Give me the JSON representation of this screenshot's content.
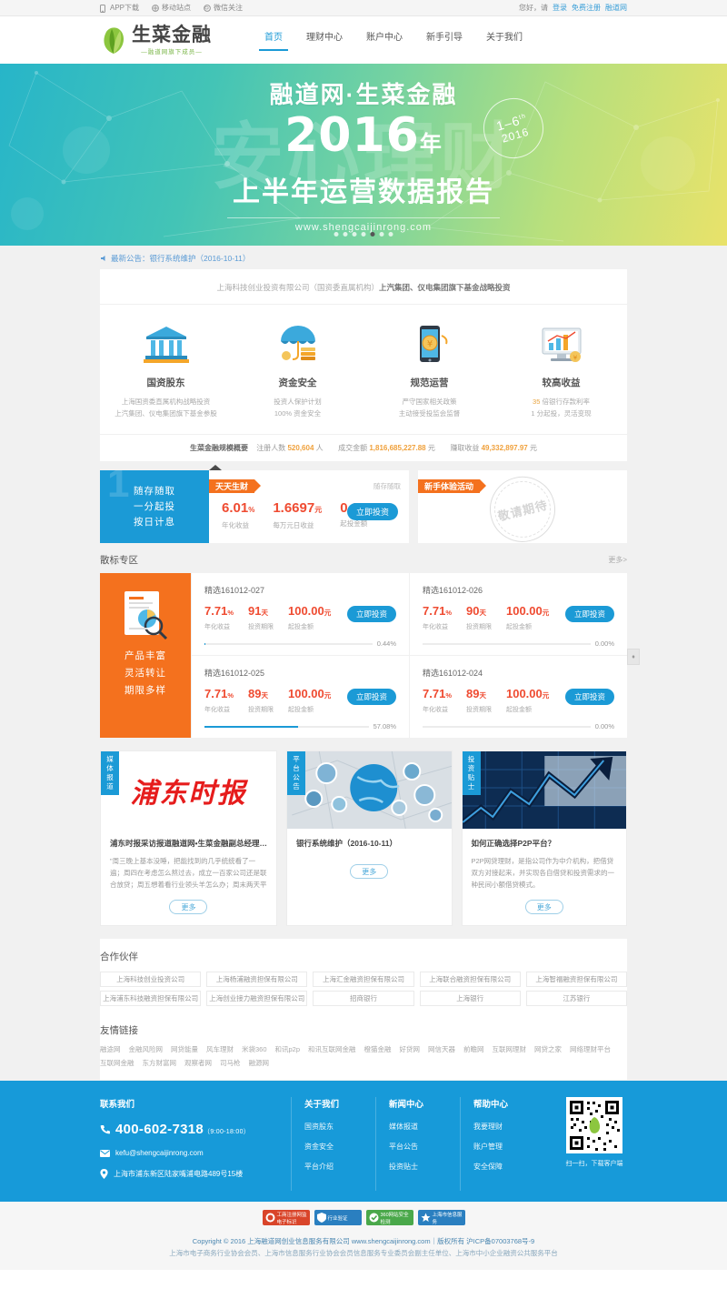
{
  "topbar": {
    "left": [
      {
        "icon": "phone-icon",
        "label": "APP下载"
      },
      {
        "icon": "mobile-site-icon",
        "label": "移动站点"
      },
      {
        "icon": "wechat-icon",
        "label": "微信关注"
      }
    ],
    "greeting": "您好，请",
    "login": "登录",
    "register": "免费注册",
    "portal": "融道网"
  },
  "header": {
    "logo_name": "生菜金融",
    "logo_sub": "—融道网旗下成员—",
    "nav": [
      {
        "label": "首页",
        "active": true
      },
      {
        "label": "理财中心",
        "active": false
      },
      {
        "label": "账户中心",
        "active": false
      },
      {
        "label": "新手引导",
        "active": false
      },
      {
        "label": "关于我们",
        "active": false
      }
    ]
  },
  "hero": {
    "ghost": "安心理财",
    "line1": "融道网·生菜金融",
    "year": "2016",
    "year_suffix": "年",
    "line3": "上半年运营数据报告",
    "url": "www.shengcaijinrong.com",
    "badge_top": "1–6",
    "badge_sup": "th",
    "badge_bottom": "2016",
    "dots_count": 7,
    "active_dot": 4
  },
  "notice": {
    "icon": "horn-icon",
    "text": "最新公告：银行系统维护（2016-10-11）"
  },
  "trust": {
    "headline_gray": "上海科技创业投资有限公司（国资委直属机构）",
    "headline_bold": "上汽集团、仪电集团旗下基金战略投资",
    "features": [
      {
        "icon": "bank-icon",
        "title": "国资股东",
        "line1": "上海国资委直属机构战略投资",
        "line2": "上汽集团、仪电集团旗下基金参股"
      },
      {
        "icon": "umbrella-money-icon",
        "title": "资金安全",
        "line1": "投资人保护计划",
        "line2": "100% 资金安全"
      },
      {
        "icon": "mobile-coin-icon",
        "title": "规范运营",
        "line1": "严守国家相关政策",
        "line2": "主动接受投监会监督"
      },
      {
        "icon": "monitor-chart-icon",
        "title": "较高收益",
        "line1_hl": "35",
        "line1": "倍银行存款利率",
        "line2": "1 分起投，灵活变现"
      }
    ],
    "stats_label": "生菜金融规模概要",
    "stats": [
      {
        "label": "注册人数",
        "value": "520,604",
        "unit": "人"
      },
      {
        "label": "成交金额",
        "value": "1,816,685,227.88",
        "unit": "元"
      },
      {
        "label": "赚取收益",
        "value": "49,332,897.97",
        "unit": "元"
      }
    ]
  },
  "deposit": {
    "left_lines": [
      "随存随取",
      "一分起投",
      "按日计息"
    ],
    "left_ghost": "1",
    "ribbon": "天天生财",
    "anytime": "随存随取",
    "stats": [
      {
        "value": "6.01",
        "unit": "%",
        "label": "年化收益"
      },
      {
        "value": "1.6697",
        "unit": "元",
        "label": "每万元日收益"
      },
      {
        "value": "0.01",
        "unit": "",
        "label": "起投金额"
      }
    ],
    "button": "立即投资",
    "promo_ribbon": "新手体验活动",
    "promo_stamp": "敬请期待"
  },
  "loans": {
    "section_title": "散标专区",
    "more": "更多>",
    "left_lines": [
      "产品丰富",
      "灵活转让",
      "期限多样"
    ],
    "left_icon": "document-search-icon",
    "side_tab": "♦",
    "items": [
      {
        "title": "精选161012-027",
        "rate": "7.71",
        "rate_unit": "%",
        "rate_label": "年化收益",
        "term": "91",
        "term_unit": "天",
        "term_label": "投资期限",
        "amount": "100.00",
        "amount_unit": "元",
        "amount_label": "起投金额",
        "button": "立即投资",
        "progress": "0.44%",
        "progress_value": 0.44
      },
      {
        "title": "精选161012-026",
        "rate": "7.71",
        "rate_unit": "%",
        "rate_label": "年化收益",
        "term": "90",
        "term_unit": "天",
        "term_label": "投资期限",
        "amount": "100.00",
        "amount_unit": "元",
        "amount_label": "起投金额",
        "button": "立即投资",
        "progress": "0.00%",
        "progress_value": 0
      },
      {
        "title": "精选161012-025",
        "rate": "7.71",
        "rate_unit": "%",
        "rate_label": "年化收益",
        "term": "89",
        "term_unit": "天",
        "term_label": "投资期限",
        "amount": "100.00",
        "amount_unit": "元",
        "amount_label": "起投金额",
        "button": "立即投资",
        "progress": "57.08%",
        "progress_value": 57.08
      },
      {
        "title": "精选161012-024",
        "rate": "7.71",
        "rate_unit": "%",
        "rate_label": "年化收益",
        "term": "89",
        "term_unit": "天",
        "term_label": "投资期限",
        "amount": "100.00",
        "amount_unit": "元",
        "amount_label": "起投金额",
        "button": "立即投资",
        "progress": "0.00%",
        "progress_value": 0
      }
    ]
  },
  "news": [
    {
      "tag": "媒体报道",
      "image": "pudong-times-masthead",
      "masthead": "浦东时报",
      "title": "浦东时报采访报道融道网•生菜金融副总经理…",
      "desc": "\"周三晚上基本没睡，把能找到的几乎统统看了一遍；周四在考虑怎么熬过去，成立一百家公司还是联合放贷；周五想着看行业领头羊怎么办；周末两天平",
      "button": "更多"
    },
    {
      "tag": "平台公告",
      "image": "global-network-photo",
      "masthead": "",
      "title": "银行系统维护（2016-10-11）",
      "desc": "",
      "button": "更多"
    },
    {
      "tag": "投资贴士",
      "image": "stock-arrow-photo",
      "masthead": "",
      "title": "如何正确选择P2P平台？",
      "desc": "P2P网贷理财，是指公司作为中介机构，把借贷双方对接起来，并实现各自借贷和投资需求的一种民间小额借贷模式。",
      "button": "更多"
    }
  ],
  "partners": {
    "title": "合作伙伴",
    "items": [
      "上海科技创业投资公司",
      "上海杨浦融资担保有限公司",
      "上海汇金融资担保有限公司",
      "上海联合融资担保有限公司",
      "上海智福融资担保有限公司",
      "上海浦东科技融资担保有限公司",
      "上海创业接力融资担保有限公司",
      "招商银行",
      "上海银行",
      "江苏银行"
    ]
  },
  "links": {
    "title": "友情链接",
    "items": [
      "融途网",
      "金融风险网",
      "网贷能量",
      "风车理财",
      "米袋360",
      "和讯p2p",
      "和讯互联网金融",
      "橙猫金融",
      "好贷网",
      "网信天器",
      "前瞻网",
      "互联网理财",
      "网贷之家",
      "网络理财平台",
      "互联网金融",
      "东方财富网",
      "观察者网",
      "司马枪",
      "融源网"
    ]
  },
  "footer": {
    "contact_title": "联系我们",
    "phone": "400-602-7318",
    "phone_hours": "（9:00-18:00）",
    "email": "kefu@shengcaijinrong.com",
    "address": "上海市浦东新区陆家嘴浦电路489号15楼",
    "columns": [
      {
        "title": "关于我们",
        "items": [
          "国资股东",
          "资金安全",
          "平台介绍"
        ]
      },
      {
        "title": "新闻中心",
        "items": [
          "媒体报道",
          "平台公告",
          "投资贴士"
        ]
      },
      {
        "title": "帮助中心",
        "items": [
          "我要理财",
          "账户管理",
          "安全保障"
        ]
      }
    ],
    "qr_caption": "扫一扫，下载客户端",
    "certs": [
      {
        "label": "工商注册网监电子标识",
        "color": "#d9452a"
      },
      {
        "label": "行业验证",
        "color": "#2a7fc0"
      },
      {
        "label": "360网站安全检测",
        "color": "#4aa84a"
      },
      {
        "label": "上海市信息服务",
        "color": "#2a7fc0"
      }
    ],
    "copyright_line1": "Copyright © 2016  上海融道网创业信息服务有限公司  www.shengcaijinrong.com｜版权所有 沪ICP备07003768号-9",
    "copyright_line2": "上海市电子商务行业协会会员、上海市信息服务行业协会会员信息服务专业委员会副主任单位、上海市中小企业融资公共服务平台"
  }
}
